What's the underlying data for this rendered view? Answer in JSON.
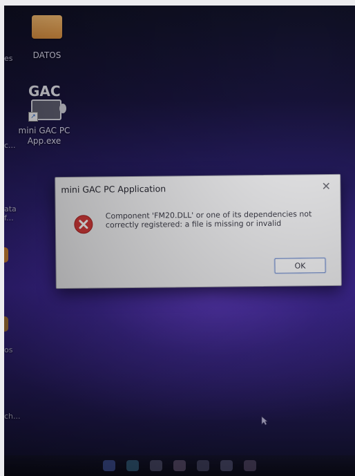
{
  "desktop": {
    "icons": [
      {
        "label": "DATOS",
        "icon": "folder-icon"
      },
      {
        "label": "mini GAC PC App.exe",
        "icon": "gac-app-icon",
        "tile_text": "GAC"
      }
    ],
    "edge_labels": [
      "es",
      "c...",
      "ata",
      "f...",
      "os",
      "ch..."
    ]
  },
  "dialog": {
    "title": "mini GAC PC Application",
    "close_glyph": "✕",
    "message": "Component 'FM20.DLL' or one of its dependencies not correctly registered: a file is missing or invalid",
    "ok_label": "OK",
    "icon": "error-icon",
    "accent_color": "#d43a3a"
  }
}
